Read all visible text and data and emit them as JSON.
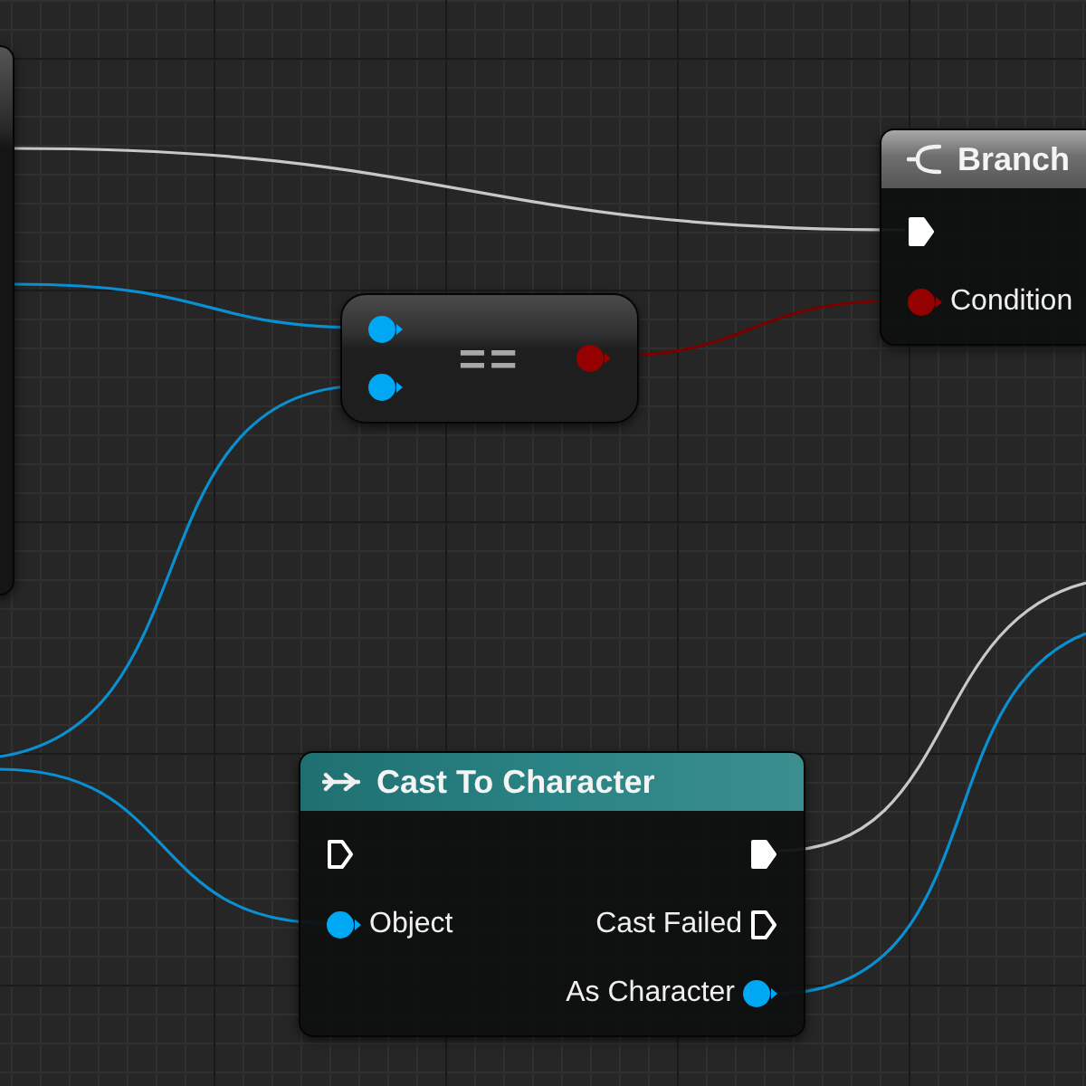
{
  "nodes": [
    {
      "kind": "branch",
      "title": "Branch",
      "rows": [
        {
          "left": {
            "kind": "exec",
            "connected": true
          }
        },
        {
          "left": {
            "kind": "bool",
            "label": "Condition",
            "connected": true
          }
        }
      ]
    },
    {
      "kind": "compact",
      "symbol": "==",
      "inputs": [
        {
          "kind": "object",
          "connected": true
        },
        {
          "kind": "object",
          "connected": true
        }
      ],
      "output": {
        "kind": "bool",
        "connected": true
      }
    },
    {
      "kind": "cast",
      "title": "Cast To Character",
      "rows": [
        {
          "left": {
            "kind": "exec",
            "connected": false
          },
          "right": {
            "kind": "exec",
            "connected": true
          }
        },
        {
          "left": {
            "kind": "object",
            "label": "Object",
            "connected": true
          },
          "right": {
            "kind": "exec",
            "label": "Cast Failed",
            "connected": false
          }
        },
        {
          "right": {
            "kind": "object",
            "label": "As Character",
            "connected": true
          }
        }
      ]
    }
  ]
}
